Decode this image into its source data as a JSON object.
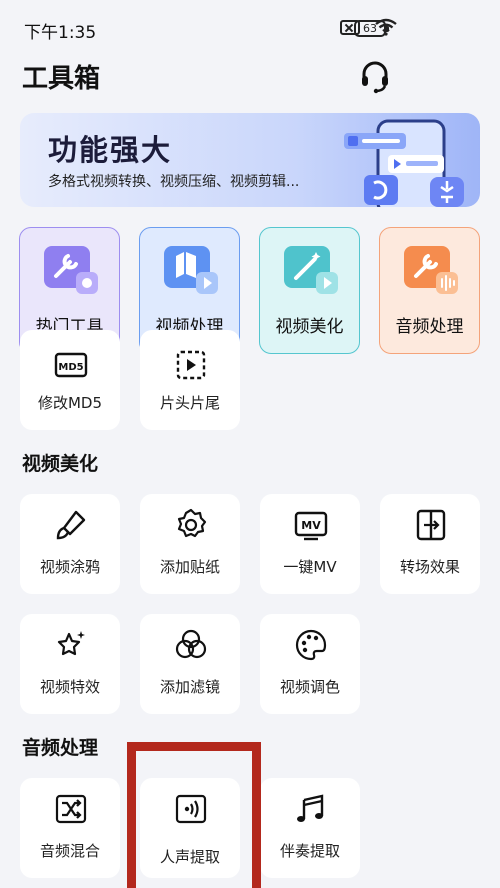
{
  "status": {
    "time": "下午1:35",
    "battery": "63"
  },
  "header": {
    "title": "工具箱",
    "support_icon": "headset-icon"
  },
  "banner": {
    "title": "功能强大",
    "subtitle": "多格式视频转换、视频压缩、视频剪辑..."
  },
  "categories": [
    {
      "label": "热门工具",
      "icon": "tool-app-icon",
      "bg": "#eae6fb",
      "border": "#9d8ef0"
    },
    {
      "label": "视频处理",
      "icon": "video-process-icon",
      "bg": "#dfeafe",
      "border": "#6b9df0"
    },
    {
      "label": "视频美化",
      "icon": "magic-wand-icon",
      "bg": "#ddf5f6",
      "border": "#55c6cf"
    },
    {
      "label": "音频处理",
      "icon": "audio-tool-icon",
      "bg": "#fde9dd",
      "border": "#f4a37a"
    }
  ],
  "hot_tools": [
    {
      "label": "修改MD5",
      "icon": "md5-icon"
    },
    {
      "label": "片头片尾",
      "icon": "intro-outro-icon"
    }
  ],
  "video_beautify": {
    "title": "视频美化",
    "items": [
      {
        "label": "视频涂鸦",
        "icon": "brush-icon"
      },
      {
        "label": "添加贴纸",
        "icon": "sticker-icon"
      },
      {
        "label": "一键MV",
        "icon": "mv-icon"
      },
      {
        "label": "转场效果",
        "icon": "transition-icon"
      },
      {
        "label": "视频特效",
        "icon": "sparkle-star-icon"
      },
      {
        "label": "添加滤镜",
        "icon": "filter-icon"
      },
      {
        "label": "视频调色",
        "icon": "palette-icon"
      }
    ]
  },
  "audio_process": {
    "title": "音频处理",
    "items": [
      {
        "label": "音频混合",
        "icon": "shuffle-mix-icon"
      },
      {
        "label": "人声提取",
        "icon": "voice-extract-icon"
      },
      {
        "label": "伴奏提取",
        "icon": "music-note-icon"
      }
    ]
  },
  "annotation": {
    "color": "#b3281d"
  }
}
